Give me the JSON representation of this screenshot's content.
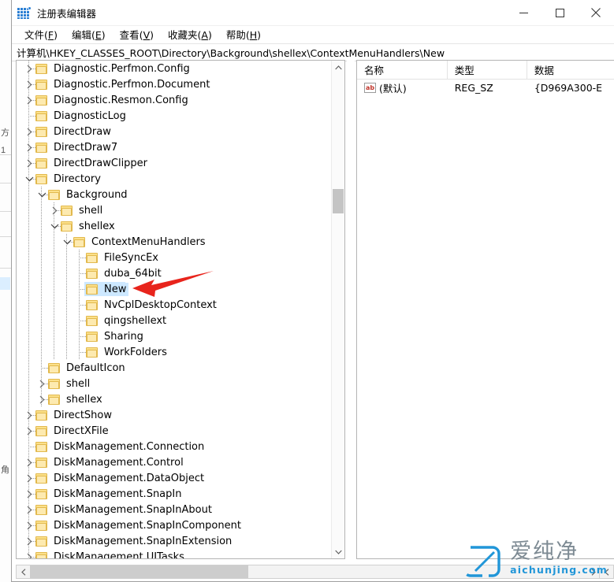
{
  "window": {
    "title": "注册表编辑器",
    "icon": "registry-editor-icon",
    "controls": {
      "minimize": "—",
      "maximize": "□",
      "close": "✕"
    }
  },
  "menubar": [
    {
      "label": "文件(F)",
      "text": "文件(",
      "accel": "F",
      "tail": ")"
    },
    {
      "label": "编辑(E)",
      "text": "编辑(",
      "accel": "E",
      "tail": ")"
    },
    {
      "label": "查看(V)",
      "text": "查看(",
      "accel": "V",
      "tail": ")"
    },
    {
      "label": "收藏夹(A)",
      "text": "收藏夹(",
      "accel": "A",
      "tail": ")"
    },
    {
      "label": "帮助(H)",
      "text": "帮助(",
      "accel": "H",
      "tail": ")"
    }
  ],
  "address": {
    "path": "计算机\\HKEY_CLASSES_ROOT\\Directory\\Background\\shellex\\ContextMenuHandlers\\New"
  },
  "tree": {
    "selected": "New",
    "items": [
      {
        "label": "Diagnostic.Perfmon.Config",
        "depth": 1,
        "expander": "collapsed"
      },
      {
        "label": "Diagnostic.Perfmon.Document",
        "depth": 1,
        "expander": "collapsed"
      },
      {
        "label": "Diagnostic.Resmon.Config",
        "depth": 1,
        "expander": "collapsed"
      },
      {
        "label": "DiagnosticLog",
        "depth": 1,
        "expander": "none"
      },
      {
        "label": "DirectDraw",
        "depth": 1,
        "expander": "collapsed"
      },
      {
        "label": "DirectDraw7",
        "depth": 1,
        "expander": "collapsed"
      },
      {
        "label": "DirectDrawClipper",
        "depth": 1,
        "expander": "collapsed"
      },
      {
        "label": "Directory",
        "depth": 1,
        "expander": "expanded"
      },
      {
        "label": "Background",
        "depth": 2,
        "expander": "expanded"
      },
      {
        "label": "shell",
        "depth": 3,
        "expander": "collapsed"
      },
      {
        "label": "shellex",
        "depth": 3,
        "expander": "expanded"
      },
      {
        "label": "ContextMenuHandlers",
        "depth": 4,
        "expander": "expanded"
      },
      {
        "label": "FileSyncEx",
        "depth": 5,
        "expander": "none"
      },
      {
        "label": "duba_64bit",
        "depth": 5,
        "expander": "none"
      },
      {
        "label": "New",
        "depth": 5,
        "expander": "none",
        "selected": true
      },
      {
        "label": "NvCplDesktopContext",
        "depth": 5,
        "expander": "none"
      },
      {
        "label": "qingshellext",
        "depth": 5,
        "expander": "none"
      },
      {
        "label": "Sharing",
        "depth": 5,
        "expander": "none"
      },
      {
        "label": "WorkFolders",
        "depth": 5,
        "expander": "none"
      },
      {
        "label": "DefaultIcon",
        "depth": 2,
        "expander": "none"
      },
      {
        "label": "shell",
        "depth": 2,
        "expander": "collapsed"
      },
      {
        "label": "shellex",
        "depth": 2,
        "expander": "collapsed"
      },
      {
        "label": "DirectShow",
        "depth": 1,
        "expander": "collapsed"
      },
      {
        "label": "DirectXFile",
        "depth": 1,
        "expander": "collapsed"
      },
      {
        "label": "DiskManagement.Connection",
        "depth": 1,
        "expander": "none"
      },
      {
        "label": "DiskManagement.Control",
        "depth": 1,
        "expander": "collapsed"
      },
      {
        "label": "DiskManagement.DataObject",
        "depth": 1,
        "expander": "collapsed"
      },
      {
        "label": "DiskManagement.SnapIn",
        "depth": 1,
        "expander": "collapsed"
      },
      {
        "label": "DiskManagement.SnapInAbout",
        "depth": 1,
        "expander": "collapsed"
      },
      {
        "label": "DiskManagement.SnapInComponent",
        "depth": 1,
        "expander": "collapsed"
      },
      {
        "label": "DiskManagement.SnapInExtension",
        "depth": 1,
        "expander": "collapsed"
      },
      {
        "label": "DiskManagement.UITasks",
        "depth": 1,
        "expander": "collapsed"
      }
    ]
  },
  "values": {
    "columns": [
      {
        "key": "name",
        "label": "名称"
      },
      {
        "key": "type",
        "label": "类型"
      },
      {
        "key": "data",
        "label": "数据"
      }
    ],
    "rows": [
      {
        "icon": "string-value-icon",
        "name": "(默认)",
        "type": "REG_SZ",
        "data": "{D969A300-E"
      }
    ]
  },
  "annotation": {
    "type": "red-arrow",
    "points_to": "New",
    "color": "#e8241c"
  },
  "watermark": {
    "logo": "aichunjing-logo",
    "cn": "爱纯净",
    "en": "aichunjing.com",
    "cn_color": "#7d8a93",
    "en_color": "#2196d8"
  },
  "scrollbars": {
    "tree_vertical": {
      "up": "∧",
      "down": "∨"
    },
    "tree_horizontal": {
      "left": "‹",
      "right": "›"
    },
    "values_horizontal": {
      "left": "‹"
    }
  }
}
